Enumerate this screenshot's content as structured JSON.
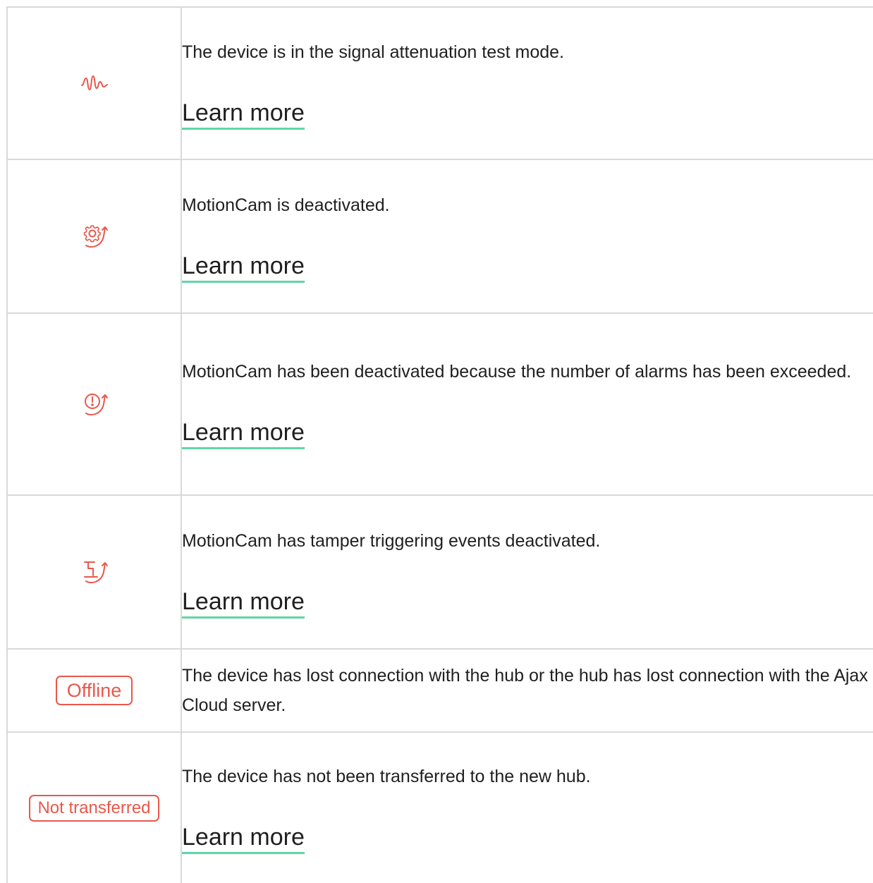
{
  "accent_color": "#e8584b",
  "link_underline_color": "#5fd6a8",
  "rows": [
    {
      "icon": "signal-wave-icon",
      "description": "The device is in the signal attenuation test mode.",
      "link": "Learn more"
    },
    {
      "icon": "gear-arrow-icon",
      "description": "MotionCam is deactivated.",
      "link": "Learn more"
    },
    {
      "icon": "alert-arrow-icon",
      "description": "MotionCam has been deactivated because the number of alarms has been exceeded.",
      "link": "Learn more"
    },
    {
      "icon": "tamper-arrow-icon",
      "description": "MotionCam has tamper triggering events deactivated.",
      "link": "Learn more"
    },
    {
      "badge": "Offline",
      "description": "The device has lost connection with the hub or the hub has lost connection with the Ajax Cloud server."
    },
    {
      "badge": "Not transferred",
      "description": "The device has not been transferred to the new hub.",
      "link": "Learn more"
    }
  ]
}
